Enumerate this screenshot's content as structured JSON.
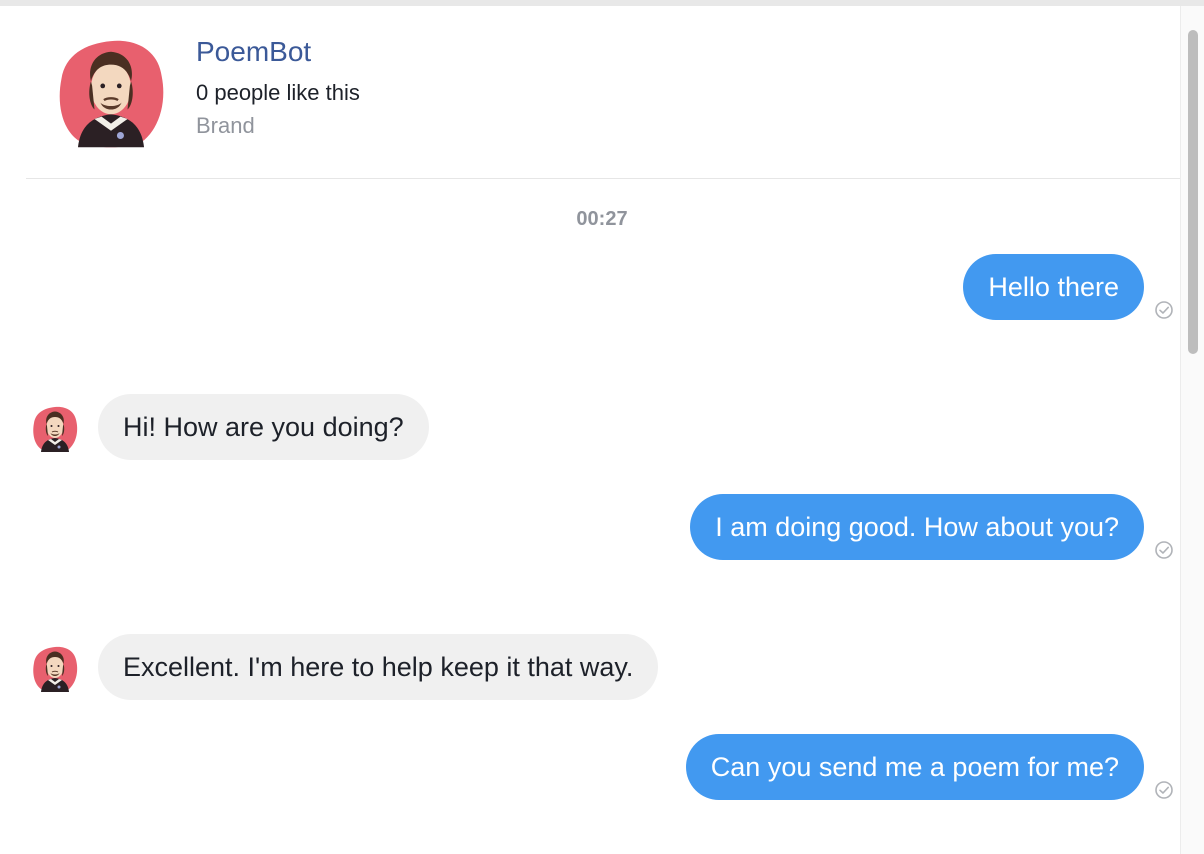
{
  "header": {
    "name": "PoemBot",
    "likes": "0 people like this",
    "category": "Brand"
  },
  "conversation": {
    "timestamp": "00:27",
    "messages": [
      {
        "from": "user",
        "text": "Hello there"
      },
      {
        "from": "bot",
        "text": "Hi! How are you doing?"
      },
      {
        "from": "user",
        "text": "I am doing good. How about you?"
      },
      {
        "from": "bot",
        "text": "Excellent. I'm here to help keep it that way."
      },
      {
        "from": "user",
        "text": "Can you send me a poem for me?"
      }
    ]
  },
  "icons": {
    "avatar": "shakespeare-portrait-avatar",
    "seen": "check-circle-icon"
  },
  "colors": {
    "outgoing_bubble": "#4299f0",
    "incoming_bubble": "#f0f0f0",
    "page_name": "#3b5998",
    "avatar_background": "#e8606e"
  }
}
